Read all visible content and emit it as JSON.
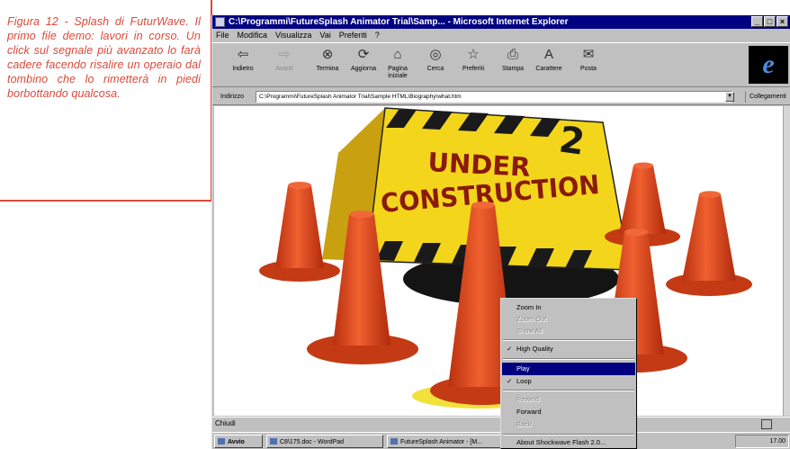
{
  "caption": "Figura 12 - Splash di FuturWave. Il primo file demo: lavori in corso. Un click sul segnale più avanzato lo farà cadere facendo risalire un operaio dal tombino che lo rimetterà in piedi borbottando qualcosa.",
  "window": {
    "title": "C:\\Programmi\\FutureSplash Animator Trial\\Samp... - Microsoft Internet Explorer",
    "buttons": [
      "_",
      "□",
      "×"
    ]
  },
  "menu": [
    "File",
    "Modifica",
    "Visualizza",
    "Vai",
    "Preferiti",
    "?"
  ],
  "toolbar": [
    {
      "label": "Indietro",
      "icon": "back-arrow-icon",
      "glyph": "⇦",
      "enabled": true
    },
    {
      "label": "Avanti",
      "icon": "forward-arrow-icon",
      "glyph": "⇨",
      "enabled": false
    },
    {
      "label": "Termina",
      "icon": "stop-icon",
      "glyph": "⊗",
      "enabled": true
    },
    {
      "label": "Aggiorna",
      "icon": "refresh-icon",
      "glyph": "⟳",
      "enabled": true
    },
    {
      "label": "Pagina iniziale",
      "icon": "home-icon",
      "glyph": "⌂",
      "enabled": true
    },
    {
      "label": "Cerca",
      "icon": "search-icon",
      "glyph": "◎",
      "enabled": true
    },
    {
      "label": "Preferiti",
      "icon": "favorites-icon",
      "glyph": "☆",
      "enabled": true
    },
    {
      "label": "Stampa",
      "icon": "print-icon",
      "glyph": "⎙",
      "enabled": true
    },
    {
      "label": "Carattere",
      "icon": "font-icon",
      "glyph": "A",
      "enabled": true
    },
    {
      "label": "Posta",
      "icon": "mail-icon",
      "glyph": "✉",
      "enabled": true
    }
  ],
  "address": {
    "label": "Indirizzo",
    "value": "C:\\Programmi\\FutureSplash Animator Trial\\Sample HTML\\Biography\\what.htm",
    "links_label": "Collegamenti"
  },
  "scene": {
    "sign_line1": "UNDER",
    "sign_line2": "CONSTRUCTION",
    "sign_colors": {
      "yellow": "#f3d51c",
      "stripe": "#1a1a1a"
    },
    "cone_color": "#e24a1e"
  },
  "context_menu": [
    {
      "label": "Zoom In",
      "enabled": true,
      "checked": false,
      "selected": false
    },
    {
      "label": "Zoom Out",
      "enabled": false,
      "checked": false,
      "selected": false
    },
    {
      "label": "Show All",
      "enabled": false,
      "checked": false,
      "selected": false
    },
    {
      "label": "High Quality",
      "enabled": true,
      "checked": true,
      "selected": false
    },
    {
      "label": "Play",
      "enabled": true,
      "checked": false,
      "selected": true
    },
    {
      "label": "Loop",
      "enabled": true,
      "checked": true,
      "selected": false
    },
    {
      "label": "Rewind",
      "enabled": false,
      "checked": false,
      "selected": false
    },
    {
      "label": "Forward",
      "enabled": true,
      "checked": false,
      "selected": false
    },
    {
      "label": "Back",
      "enabled": false,
      "checked": false,
      "selected": false
    },
    {
      "label": "About Shockwave Flash 2.0...",
      "enabled": true,
      "checked": false,
      "selected": false
    }
  ],
  "status": "Chiudi",
  "taskbar": {
    "start": "Avvio",
    "tasks": [
      "C8\\175.doc - WordPad",
      "FutureSplash Animator - [M..."
    ],
    "clock": "17.00"
  }
}
